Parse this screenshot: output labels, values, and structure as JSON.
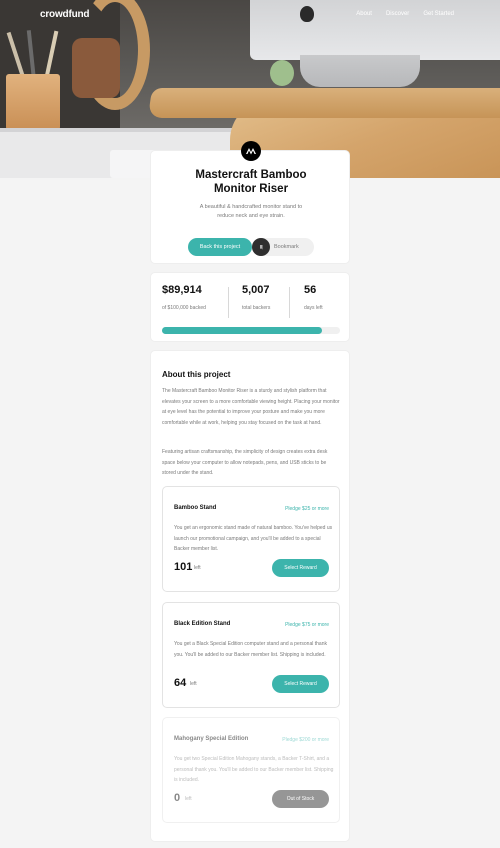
{
  "brand": {
    "name": "crowdfund"
  },
  "nav": {
    "links": [
      "About",
      "Discover",
      "Get Started"
    ]
  },
  "project": {
    "title_line1": "Mastercraft Bamboo",
    "title_line2": "Monitor Riser",
    "description": "A beautiful & handcrafted monitor stand to reduce neck and eye strain.",
    "back_label": "Back this project",
    "bookmark_label": "Bookmark",
    "logo_icon": "mastercraft-logo-icon"
  },
  "stats": {
    "backed_amount": "$89,914",
    "backed_label": "of $100,000 backed",
    "backers": "5,007",
    "backers_label": "total backers",
    "days": "56",
    "days_label": "days left",
    "progress_fraction": 0.899
  },
  "about": {
    "title": "About this project",
    "paragraph1": "The Mastercraft Bamboo Monitor Riser is a sturdy and stylish platform that elevates your screen to a more comfortable viewing height. Placing your monitor at eye level has the potential to improve your posture and make you more comfortable while at work, helping you stay focused on the task at hand.",
    "paragraph2": "Featuring artisan craftsmanship, the simplicity of design creates extra desk space below your computer to allow notepads, pens, and USB sticks to be stored under the stand."
  },
  "rewards": [
    {
      "name": "Bamboo Stand",
      "pledge": "Pledge $25 or more",
      "description": "You get an ergonomic stand made of natural bamboo. You've helped us launch our promotional campaign, and you'll be added to a special Backer member list.",
      "count": "101",
      "left_label": "left",
      "button": "Select Reward"
    },
    {
      "name": "Black Edition Stand",
      "pledge": "Pledge $75 or more",
      "description": "You get a Black Special Edition computer stand and a personal thank you. You'll be added to our Backer member list. Shipping is included.",
      "count": "64",
      "left_label": "left",
      "button": "Select Reward"
    },
    {
      "name": "Mahogany Special Edition",
      "pledge": "Pledge $200 or more",
      "description": "You get two Special Edition Mahogany stands, a Backer T-Shirt, and a personal thank you. You'll be added to our Backer member list. Shipping is included.",
      "count": "0",
      "left_label": "left",
      "button": "Out of Stock"
    }
  ],
  "colors": {
    "accent": "#3cb4ac",
    "dark": "#2f2f2f",
    "text_muted": "#7a7a7a",
    "background": "#f4f4f4"
  }
}
